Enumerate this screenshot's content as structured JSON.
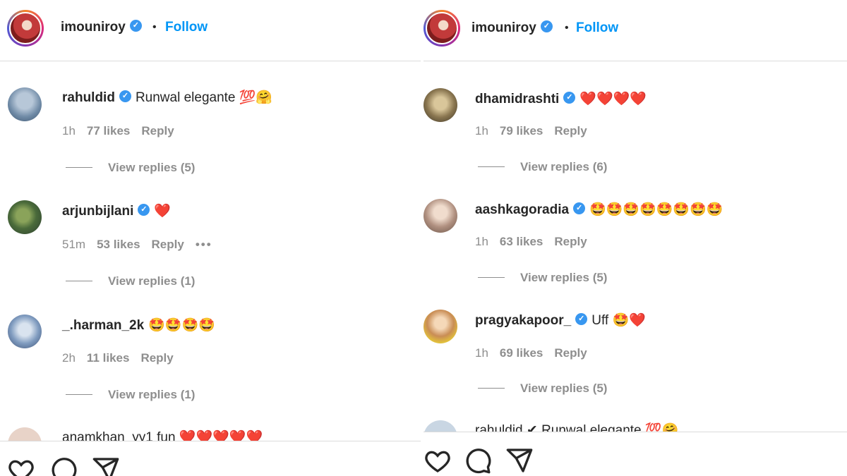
{
  "left": {
    "header": {
      "username": "imouniroy",
      "follow": "Follow"
    },
    "comments": [
      {
        "user": "rahuldid",
        "verified": true,
        "text": "Runwal elegante 💯🤗",
        "time": "1h",
        "likes": "77 likes",
        "reply": "Reply",
        "replies": "View replies (5)"
      },
      {
        "user": "arjunbijlani",
        "verified": true,
        "text": "❤️",
        "time": "51m",
        "likes": "53 likes",
        "reply": "Reply",
        "more": "•••",
        "replies": "View replies (1)"
      },
      {
        "user": "_.harman_2k",
        "verified": false,
        "text": "🤩🤩🤩🤩",
        "time": "2h",
        "likes": "11 likes",
        "reply": "Reply",
        "replies": "View replies (1)"
      }
    ],
    "partial": "anamkhan_yy1 fun ❤️❤️❤️❤️❤️"
  },
  "right": {
    "header": {
      "username": "imouniroy",
      "follow": "Follow"
    },
    "comments": [
      {
        "user": "dhamidrashti",
        "verified": true,
        "text": "❤️❤️❤️❤️",
        "time": "1h",
        "likes": "79 likes",
        "reply": "Reply",
        "replies": "View replies (6)"
      },
      {
        "user": "aashkagoradia",
        "verified": true,
        "text": "🤩🤩🤩🤩🤩🤩🤩🤩",
        "time": "1h",
        "likes": "63 likes",
        "reply": "Reply",
        "replies": "View replies (5)"
      },
      {
        "user": "pragyakapoor_",
        "verified": true,
        "text": "Uff 🤩❤️",
        "time": "1h",
        "likes": "69 likes",
        "reply": "Reply",
        "replies": "View replies (5)"
      }
    ],
    "partial": "rahuldid ✔ Runwal elegante 💯🤗"
  },
  "icons": [
    "heart-icon",
    "comment-icon",
    "share-icon",
    "verified-badge-icon"
  ],
  "colors": {
    "accent": "#0095f6",
    "verified": "#3897f0",
    "muted": "#8e8e8e",
    "border": "#dbdbdb"
  }
}
